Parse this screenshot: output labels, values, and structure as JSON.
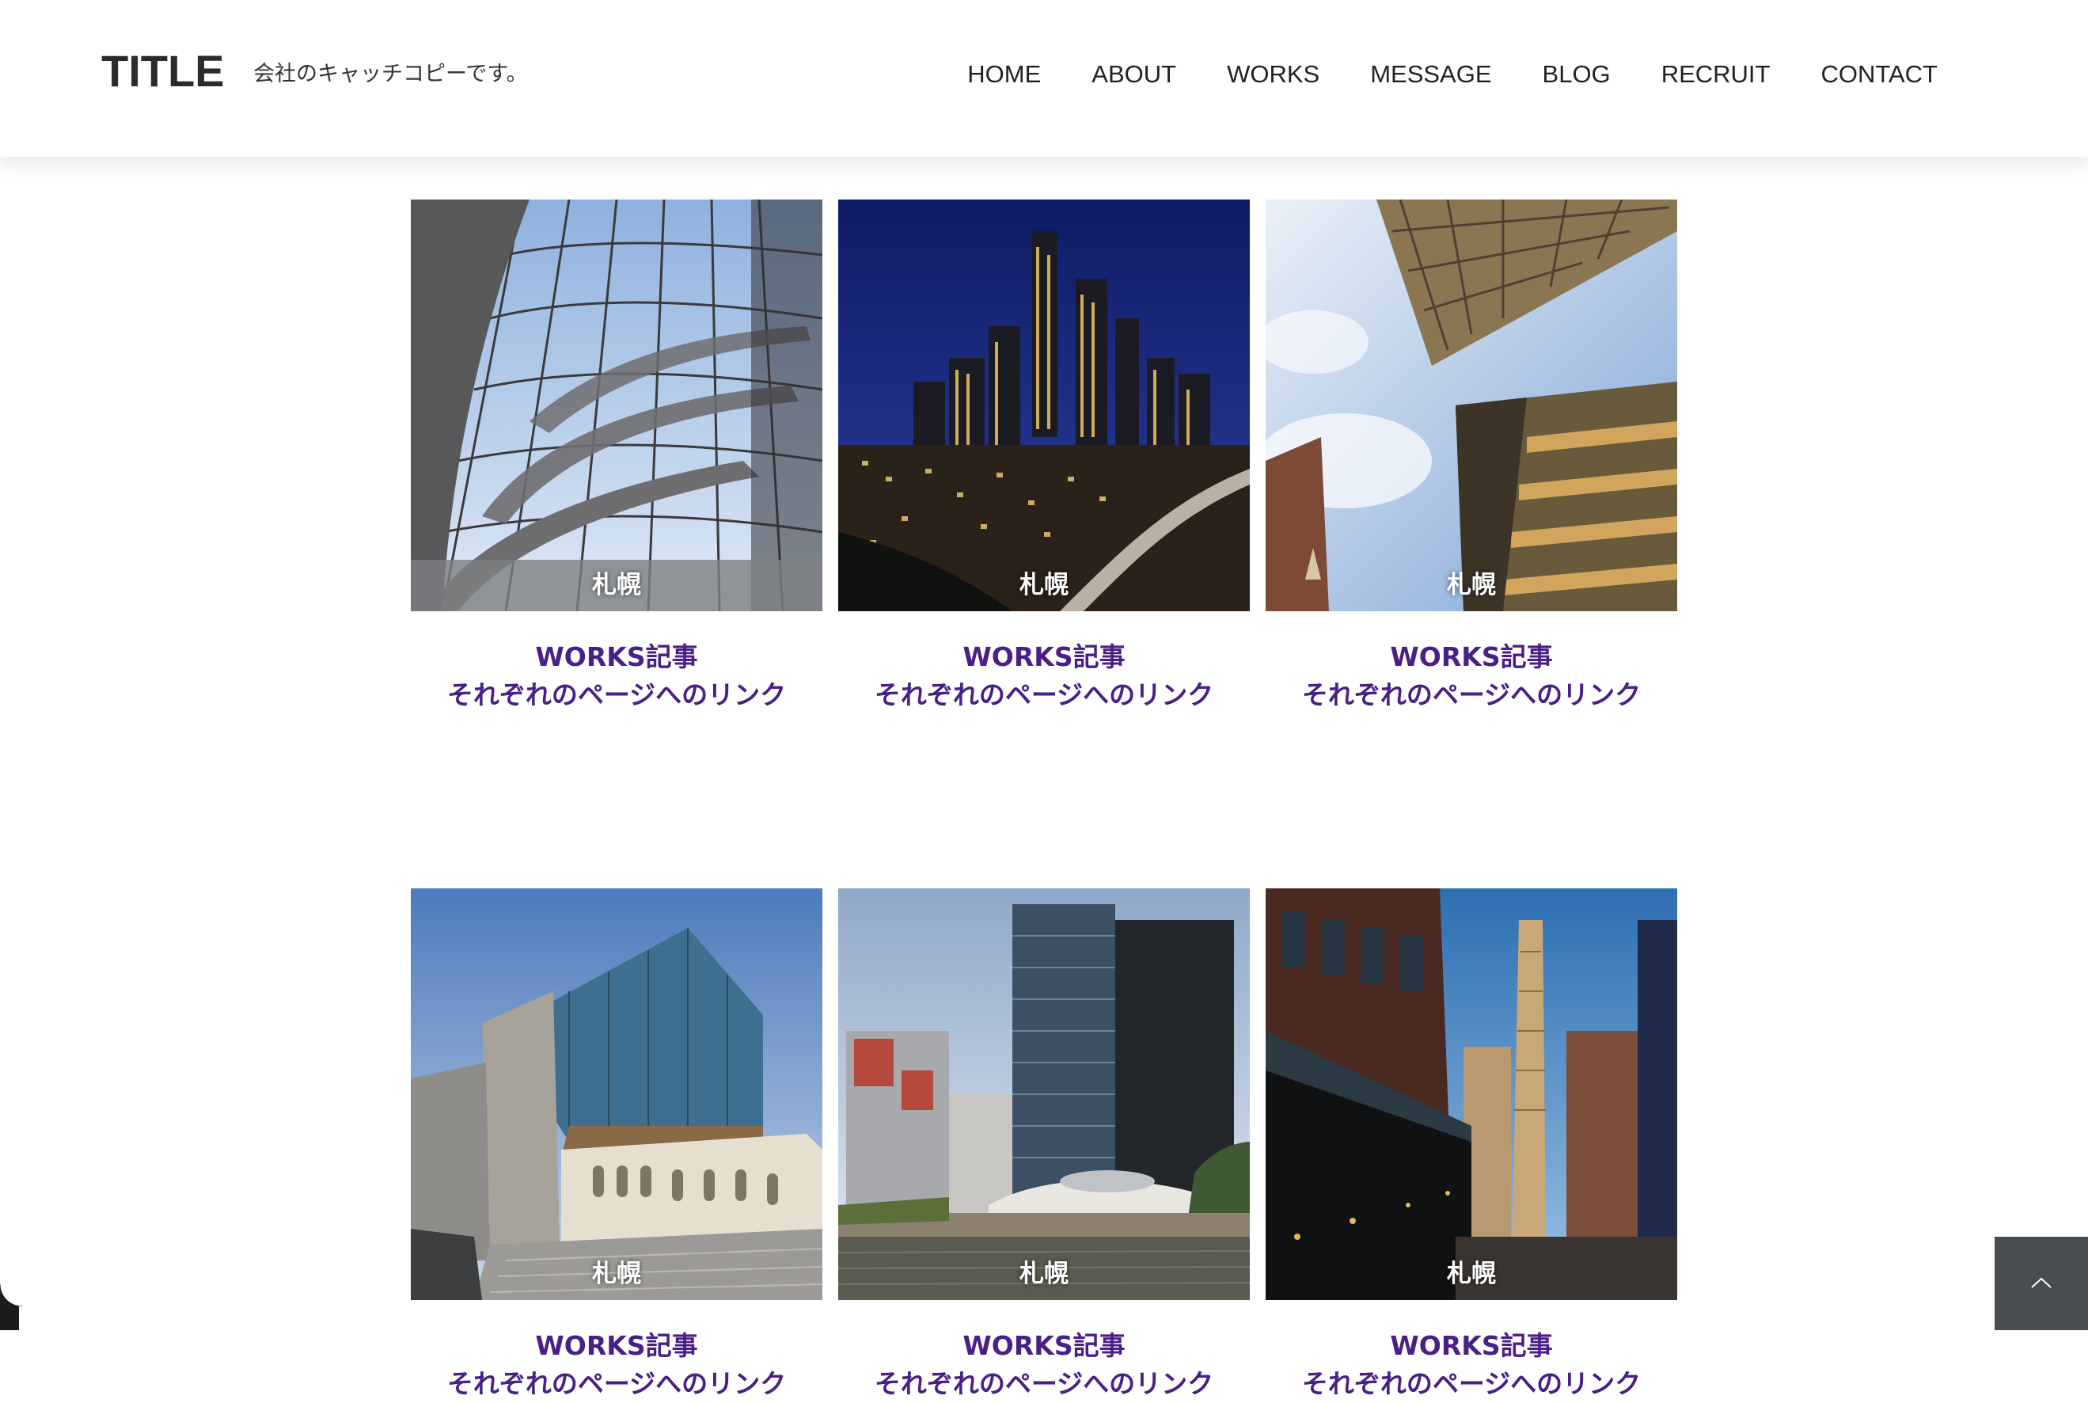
{
  "header": {
    "title": "TITLE",
    "tagline": "会社のキャッチコピーです。",
    "nav": [
      "HOME",
      "ABOUT",
      "WORKS",
      "MESSAGE",
      "BLOG",
      "RECRUIT",
      "CONTACT"
    ]
  },
  "works": [
    {
      "tag": "札幌",
      "line1": "WORKS記事",
      "line2": "それぞれのページへのリンク"
    },
    {
      "tag": "札幌",
      "line1": "WORKS記事",
      "line2": "それぞれのページへのリンク"
    },
    {
      "tag": "札幌",
      "line1": "WORKS記事",
      "line2": "それぞれのページへのリンク"
    },
    {
      "tag": "札幌",
      "line1": "WORKS記事",
      "line2": "それぞれのページへのリンク"
    },
    {
      "tag": "札幌",
      "line1": "WORKS記事",
      "line2": "それぞれのページへのリンク"
    },
    {
      "tag": "札幌",
      "line1": "WORKS記事",
      "line2": "それぞれのページへのリンク"
    }
  ],
  "colors": {
    "link": "#4a1f86",
    "to_top_bg": "#4a4d50"
  },
  "icons": {
    "to_top": "chevron-up-icon"
  }
}
